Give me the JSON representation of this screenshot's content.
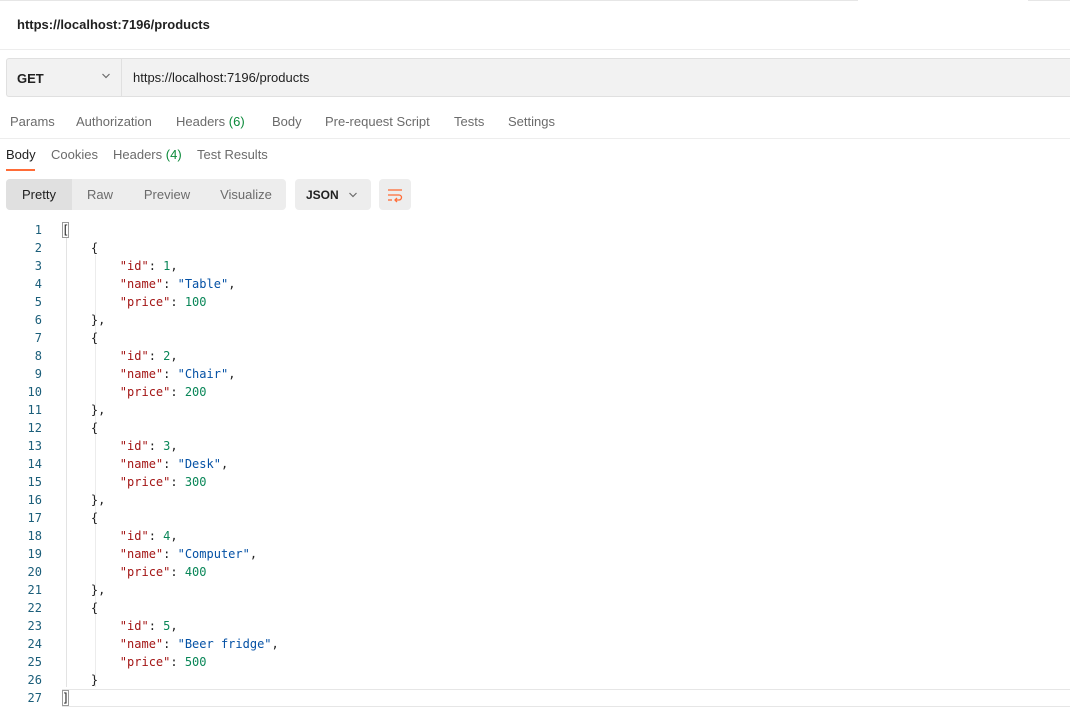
{
  "window": {
    "title": "https://localhost:7196/products"
  },
  "request": {
    "method": "GET",
    "url": "https://localhost:7196/products",
    "tabs": [
      {
        "label": "Params"
      },
      {
        "label": "Authorization"
      },
      {
        "label": "Headers",
        "count": "(6)"
      },
      {
        "label": "Body"
      },
      {
        "label": "Pre-request Script"
      },
      {
        "label": "Tests"
      },
      {
        "label": "Settings"
      }
    ]
  },
  "response": {
    "tabs": [
      {
        "label": "Body",
        "active": true
      },
      {
        "label": "Cookies"
      },
      {
        "label": "Headers",
        "count": "(4)"
      },
      {
        "label": "Test Results"
      }
    ],
    "view_modes": [
      "Pretty",
      "Raw",
      "Preview",
      "Visualize"
    ],
    "format": "JSON",
    "icons": {
      "caret": "chevron-down-icon",
      "wrap": "word-wrap-icon"
    },
    "accent_color": "#ff6c37",
    "body_lines": [
      "[",
      "    {",
      "        \"id\": 1,",
      "        \"name\": \"Table\",",
      "        \"price\": 100",
      "    },",
      "    {",
      "        \"id\": 2,",
      "        \"name\": \"Chair\",",
      "        \"price\": 200",
      "    },",
      "    {",
      "        \"id\": 3,",
      "        \"name\": \"Desk\",",
      "        \"price\": 300",
      "    },",
      "    {",
      "        \"id\": 4,",
      "        \"name\": \"Computer\",",
      "        \"price\": 400",
      "    },",
      "    {",
      "        \"id\": 5,",
      "        \"name\": \"Beer fridge\",",
      "        \"price\": 500",
      "    }",
      "]"
    ]
  }
}
